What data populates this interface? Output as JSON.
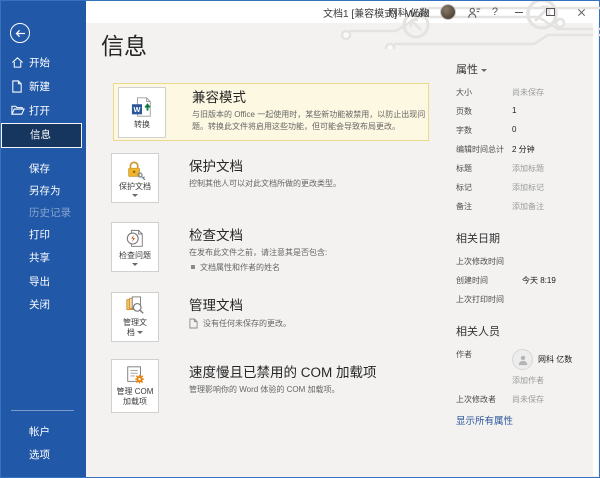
{
  "window": {
    "title": "文档1 [兼容模式] - Word",
    "user_name": "网科 亿数",
    "help_label": "?"
  },
  "sidebar": {
    "items": [
      {
        "label": "开始",
        "icon": "home-icon"
      },
      {
        "label": "新建",
        "icon": "new-document-icon"
      },
      {
        "label": "打开",
        "icon": "open-folder-icon"
      },
      {
        "label": "信息",
        "selected": true
      },
      {
        "label": "保存"
      },
      {
        "label": "另存为"
      },
      {
        "label": "历史记录",
        "disabled": true
      },
      {
        "label": "打印"
      },
      {
        "label": "共享"
      },
      {
        "label": "导出"
      },
      {
        "label": "关闭"
      },
      {
        "label": "帐户"
      },
      {
        "label": "选项"
      }
    ]
  },
  "page": {
    "title": "信息"
  },
  "sections": [
    {
      "title": "兼容模式",
      "desc": "与旧版本的 Office 一起使用时，某些新功能被禁用，以防止出现问题。转换此文件将启用这些功能，但可能会导致布局更改。",
      "tile_label": "转换",
      "icon": "word-convert-icon"
    },
    {
      "title": "保护文档",
      "desc": "控制其他人可以对此文档所做的更改类型。",
      "tile_label": "保护文档",
      "icon": "lock-key-icon"
    },
    {
      "title": "检查文档",
      "desc": "在发布此文件之前，请注意其是否包含:",
      "bullet": "文档属性和作者的姓名",
      "tile_label": "检查问题",
      "icon": "inspect-document-icon"
    },
    {
      "title": "管理文档",
      "note": "没有任何未保存的更改。",
      "tile_label": "管理文档",
      "icon": "manage-document-icon"
    },
    {
      "title": "速度慢且已禁用的 COM 加载项",
      "desc": "管理影响你的 Word 体验的 COM 加载项。",
      "tile_label": "管理 COM 加载项",
      "icon": "com-addins-icon"
    }
  ],
  "panel": {
    "properties": {
      "header": "属性",
      "rows": [
        {
          "label": "大小",
          "value": "尚未保存",
          "placeholder": true
        },
        {
          "label": "页数",
          "value": "1"
        },
        {
          "label": "字数",
          "value": "0"
        },
        {
          "label": "编辑时间总计",
          "value": "2 分钟"
        },
        {
          "label": "标题",
          "value": "添加标题",
          "placeholder": true
        },
        {
          "label": "标记",
          "value": "添加标记",
          "placeholder": true
        },
        {
          "label": "备注",
          "value": "添加备注",
          "placeholder": true
        }
      ]
    },
    "dates": {
      "header": "相关日期",
      "rows": [
        {
          "label": "上次修改时间",
          "value": ""
        },
        {
          "label": "创建时间",
          "value": "今天 8:19"
        },
        {
          "label": "上次打印时间",
          "value": ""
        }
      ]
    },
    "people": {
      "header": "相关人员",
      "author_label": "作者",
      "author_name": "网科 亿数",
      "add_author": "添加作者",
      "last_modified_by_label": "上次修改者",
      "last_modified_by_value": "尚未保存"
    },
    "show_all_link": "显示所有属性"
  },
  "colors": {
    "sidebar_blue": "#2158A8",
    "selected_navy": "#16355F",
    "highlight_bg": "#FDF8E1",
    "highlight_border": "#EBDA8C",
    "link_blue": "#2B579A",
    "lock_gold": "#F0B429",
    "gear_orange": "#E8820C",
    "convert_green": "#107C41",
    "word_blue": "#2B579A"
  }
}
